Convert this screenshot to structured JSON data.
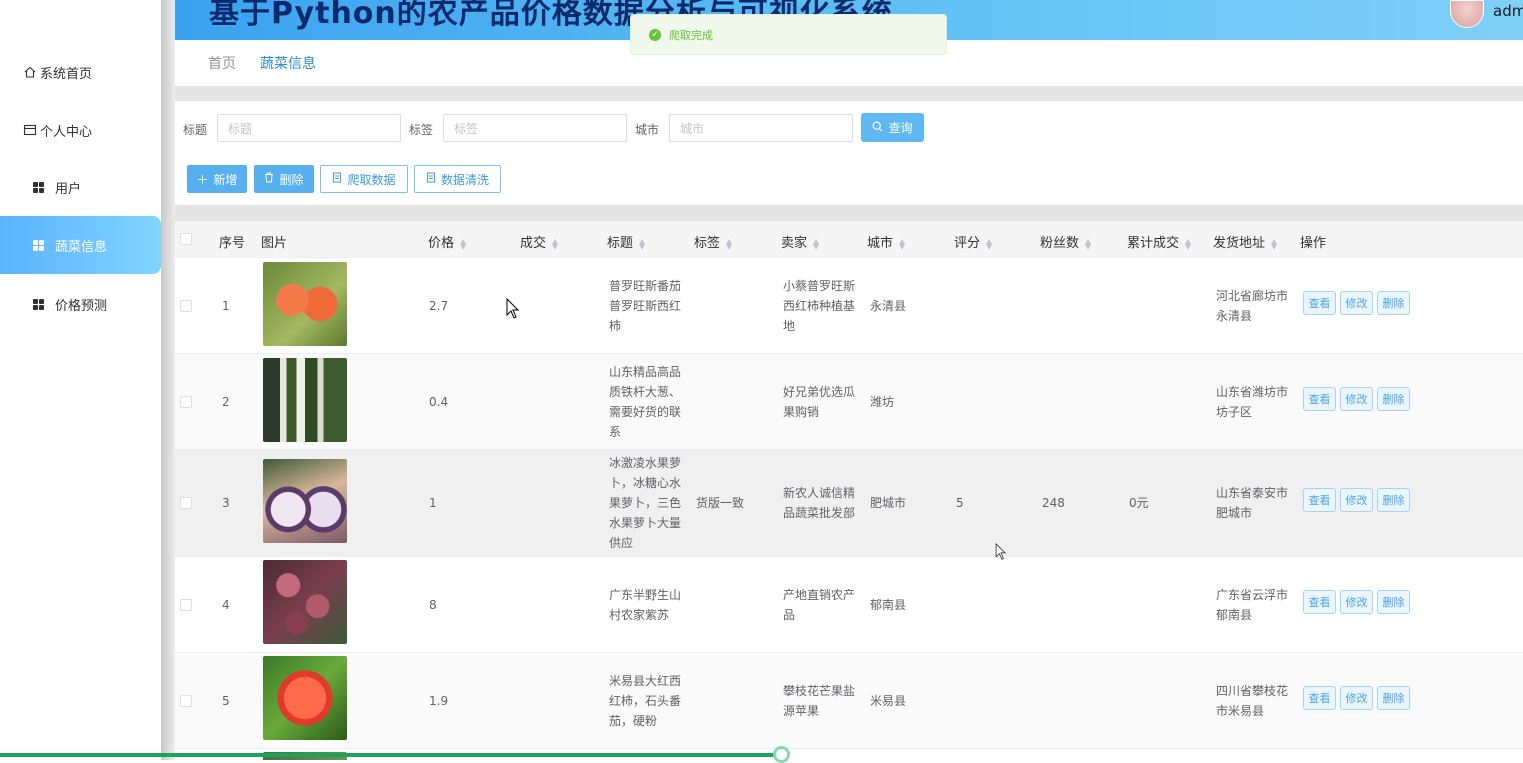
{
  "app": {
    "title": "基于Python的农产品价格数据分析与可视化系统",
    "user": "admi"
  },
  "sidebar": {
    "items": [
      {
        "label": "系统首页",
        "icon": "home-icon"
      },
      {
        "label": "个人中心",
        "icon": "card-icon"
      },
      {
        "label": "用户",
        "icon": "grid-icon"
      },
      {
        "label": "蔬菜信息",
        "icon": "grid-icon",
        "active": true
      },
      {
        "label": "价格预测",
        "icon": "grid-icon"
      }
    ]
  },
  "breadcrumb": {
    "home": "首页",
    "current": "蔬菜信息"
  },
  "toast": {
    "message": "爬取完成",
    "color": "#67c23a"
  },
  "search": {
    "title_label": "标题",
    "title_placeholder": "标题",
    "tag_label": "标签",
    "tag_placeholder": "标签",
    "city_label": "城市",
    "city_placeholder": "城市",
    "query_button": "查询"
  },
  "actions": {
    "add": "新增",
    "delete": "删除",
    "crawl": "爬取数据",
    "clean": "数据清洗"
  },
  "table": {
    "headers": {
      "index": "序号",
      "image": "图片",
      "price": "价格",
      "deal": "成交",
      "title": "标题",
      "tag": "标签",
      "seller": "卖家",
      "city": "城市",
      "rating": "评分",
      "fans": "粉丝数",
      "total_deal": "累计成交",
      "ship_addr": "发货地址",
      "ops": "操作"
    },
    "op_labels": {
      "view": "查看",
      "edit": "修改",
      "delete": "删除"
    },
    "rows": [
      {
        "index": "1",
        "price": "2.7",
        "deal": "",
        "title": "普罗旺斯番茄普罗旺斯西红柿",
        "tag": "",
        "seller": "小蔡普罗旺斯西红柿种植基地",
        "city": "永清县",
        "rating": "",
        "fans": "",
        "total_deal": "",
        "ship_addr": "河北省廊坊市永清县"
      },
      {
        "index": "2",
        "price": "0.4",
        "deal": "",
        "title": "山东精品高品质铁杆大葱、需要好货的联系",
        "tag": "",
        "seller": "好兄弟优选瓜果购销",
        "city": "潍坊",
        "rating": "",
        "fans": "",
        "total_deal": "",
        "ship_addr": "山东省潍坊市坊子区"
      },
      {
        "index": "3",
        "price": "1",
        "deal": "",
        "title": "冰激凌水果萝卜，冰糖心水果萝卜，三色水果萝卜大量供应",
        "tag": "货版一致",
        "seller": "新农人诚信精品蔬菜批发部",
        "city": "肥城市",
        "rating": "5",
        "fans": "248",
        "total_deal": "0元",
        "ship_addr": "山东省泰安市肥城市"
      },
      {
        "index": "4",
        "price": "8",
        "deal": "",
        "title": "广东半野生山村农家紫苏",
        "tag": "",
        "seller": "产地直销农产品",
        "city": "郁南县",
        "rating": "",
        "fans": "",
        "total_deal": "",
        "ship_addr": "广东省云浮市郁南县"
      },
      {
        "index": "5",
        "price": "1.9",
        "deal": "",
        "title": "米易县大红西红柿，石头番茄，硬粉",
        "tag": "",
        "seller": "攀枝花芒果盐源苹果",
        "city": "米易县",
        "rating": "",
        "fans": "",
        "total_deal": "",
        "ship_addr": "四川省攀枝花市米易县"
      }
    ]
  },
  "colors": {
    "accent": "#409eff",
    "active_nav": "#5cb3ff",
    "progress": "#1aa35a"
  },
  "progress": {
    "value": 0.513
  }
}
